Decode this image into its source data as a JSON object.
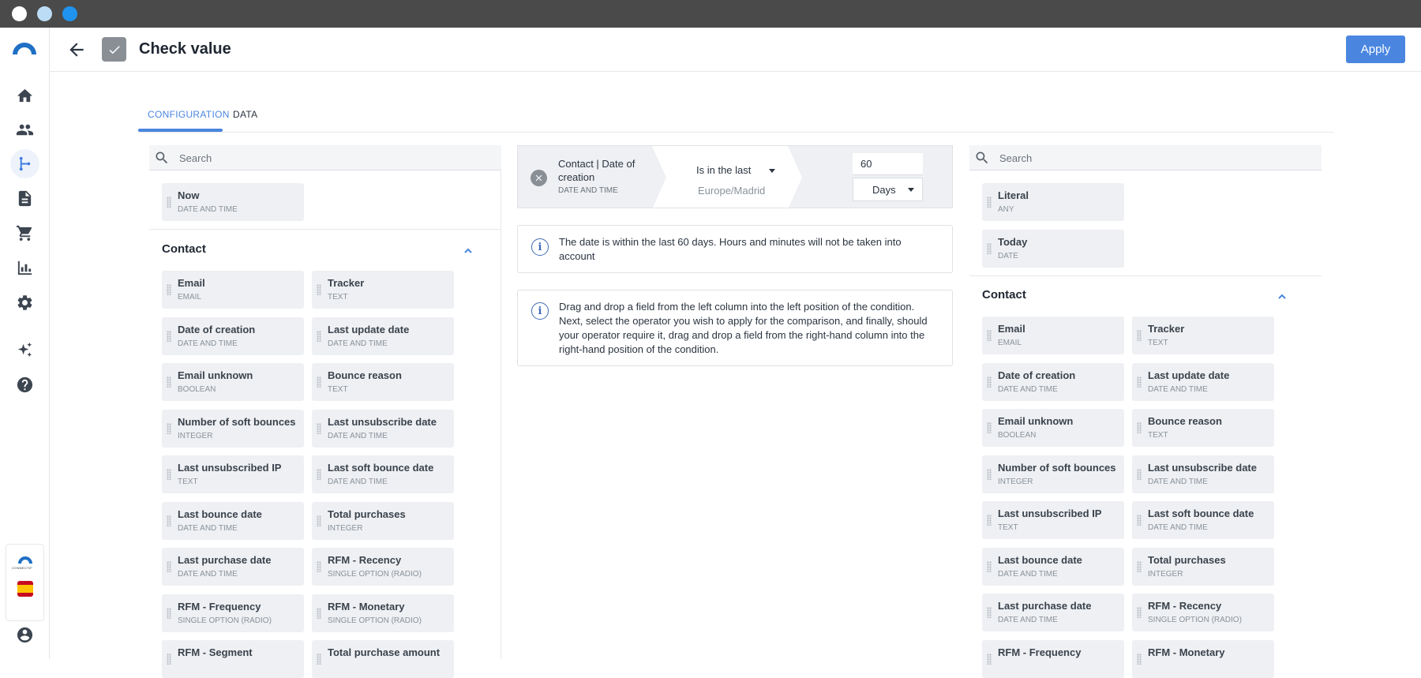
{
  "window": {
    "title": "Check value"
  },
  "header": {
    "title": "Check value",
    "apply_label": "Apply"
  },
  "sidebar": {
    "items": [
      "home-icon",
      "contacts-icon",
      "automation-flow-icon",
      "document-icon",
      "cart-icon",
      "analytics-icon",
      "settings-icon",
      "sparkle-icon",
      "help-icon"
    ],
    "brand": "CONNECTIF"
  },
  "tabs": [
    {
      "label": "CONFIGURATION",
      "active": true
    },
    {
      "label": "DATA",
      "active": false
    }
  ],
  "left": {
    "search_placeholder": "Search",
    "top_fields": [
      {
        "name": "Now",
        "type": "DATE AND TIME"
      }
    ],
    "section_title": "Contact",
    "fields": [
      {
        "name": "Email",
        "type": "EMAIL"
      },
      {
        "name": "Tracker",
        "type": "TEXT"
      },
      {
        "name": "Date of creation",
        "type": "DATE AND TIME"
      },
      {
        "name": "Last update date",
        "type": "DATE AND TIME"
      },
      {
        "name": "Email unknown",
        "type": "BOOLEAN"
      },
      {
        "name": "Bounce reason",
        "type": "TEXT"
      },
      {
        "name": "Number of soft bounces",
        "type": "INTEGER"
      },
      {
        "name": "Last unsubscribe date",
        "type": "DATE AND TIME"
      },
      {
        "name": "Last unsubscribed IP",
        "type": "TEXT"
      },
      {
        "name": "Last soft bounce date",
        "type": "DATE AND TIME"
      },
      {
        "name": "Last bounce date",
        "type": "DATE AND TIME"
      },
      {
        "name": "Total purchases",
        "type": "INTEGER"
      },
      {
        "name": "Last purchase date",
        "type": "DATE AND TIME"
      },
      {
        "name": "RFM - Recency",
        "type": "SINGLE OPTION (RADIO)"
      },
      {
        "name": "RFM - Frequency",
        "type": "SINGLE OPTION (RADIO)"
      },
      {
        "name": "RFM - Monetary",
        "type": "SINGLE OPTION (RADIO)"
      },
      {
        "name": "RFM - Segment",
        "type": ""
      },
      {
        "name": "Total purchase amount",
        "type": ""
      }
    ]
  },
  "condition": {
    "field": "Contact | Date of creation",
    "field_type": "DATE AND TIME",
    "operator": "Is in the last",
    "timezone": "Europe/Madrid",
    "value": "60",
    "unit": "Days"
  },
  "info": {
    "summary": "The date is within the last 60 days. Hours and minutes will not be taken into account",
    "help": "Drag and drop a field from the left column into the left position of the condition. Next, select the operator you wish to apply for the comparison, and finally, should your operator require it, drag and drop a field from the right-hand column into the right-hand position of the condition."
  },
  "right": {
    "search_placeholder": "Search",
    "top_fields": [
      {
        "name": "Literal",
        "type": "ANY"
      },
      {
        "name": "Today",
        "type": "DATE"
      }
    ],
    "section_title": "Contact",
    "fields": [
      {
        "name": "Email",
        "type": "EMAIL"
      },
      {
        "name": "Tracker",
        "type": "TEXT"
      },
      {
        "name": "Date of creation",
        "type": "DATE AND TIME"
      },
      {
        "name": "Last update date",
        "type": "DATE AND TIME"
      },
      {
        "name": "Email unknown",
        "type": "BOOLEAN"
      },
      {
        "name": "Bounce reason",
        "type": "TEXT"
      },
      {
        "name": "Number of soft bounces",
        "type": "INTEGER"
      },
      {
        "name": "Last unsubscribe date",
        "type": "DATE AND TIME"
      },
      {
        "name": "Last unsubscribed IP",
        "type": "TEXT"
      },
      {
        "name": "Last soft bounce date",
        "type": "DATE AND TIME"
      },
      {
        "name": "Last bounce date",
        "type": "DATE AND TIME"
      },
      {
        "name": "Total purchases",
        "type": "INTEGER"
      },
      {
        "name": "Last purchase date",
        "type": "DATE AND TIME"
      },
      {
        "name": "RFM - Recency",
        "type": "SINGLE OPTION (RADIO)"
      },
      {
        "name": "RFM - Frequency",
        "type": ""
      },
      {
        "name": "RFM - Monetary",
        "type": ""
      }
    ]
  },
  "colors": {
    "accent": "#4a86e0",
    "chip_bg": "#eef0f3",
    "titlebar": "#4a4a4a"
  }
}
